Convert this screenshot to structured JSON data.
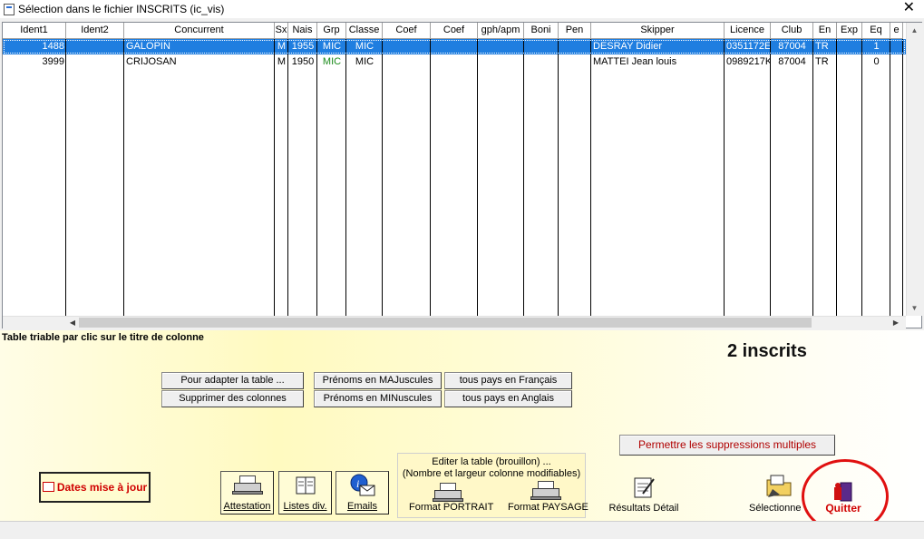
{
  "window": {
    "title": "Sélection dans le fichier INSCRITS (ic_vis)",
    "close_glyph": "✕"
  },
  "table": {
    "columns": [
      "Ident1",
      "Ident2",
      "Concurrent",
      "Sx",
      "Nais",
      "Grp",
      "Classe",
      "Coef",
      "Coef",
      "gph/apm",
      "Boni",
      "Pen",
      "Skipper",
      "Licence",
      "Club",
      "En",
      "Exp",
      "Eq",
      "e"
    ],
    "rows": [
      [
        "1488",
        "",
        "GALOPIN",
        "M",
        "1955",
        "MIC",
        "MIC",
        "",
        "",
        "",
        "",
        "",
        "DESRAY Didier",
        "0351172E",
        "87004",
        "TR",
        "",
        "1",
        ""
      ],
      [
        "3999",
        "",
        "CRIJOSAN",
        "M",
        "1950",
        "MIC",
        "MIC",
        "",
        "",
        "",
        "",
        "",
        "MATTEI Jean louis",
        "0989217K",
        "87004",
        "TR",
        "",
        "0",
        ""
      ]
    ],
    "selected_row": 0
  },
  "footer": {
    "sort_hint": "Table triable par clic sur le titre de colonne",
    "count_label": "2 inscrits",
    "buttons": {
      "adapt": "Pour adapter la table ...",
      "delete_cols": "Supprimer des colonnes",
      "prenoms_maj": "Prénoms en MAJuscules",
      "prenoms_min": "Prénoms en MINuscules",
      "pays_fr": "tous pays en Français",
      "pays_en": "tous pays en Anglais",
      "multi_delete": "Permettre les suppressions multiples",
      "dates": "Dates mise à jour",
      "attestation": "Attestation",
      "listes": "Listes div.",
      "emails": "Emails",
      "resultats": "Résultats Détail",
      "selectionne": "Sélectionne",
      "quitter": "Quitter"
    },
    "edit_box": {
      "line1": "Editer la table (brouillon) ...",
      "line2": "(Nombre et largeur colonne modifiables)",
      "portrait": "Format PORTRAIT",
      "paysage": "Format PAYSAGE"
    }
  },
  "colors": {
    "selection": "#1f7ee0",
    "grp_text": "#1a8a1a",
    "quit_red": "#d00000",
    "circle": "#e01010"
  }
}
